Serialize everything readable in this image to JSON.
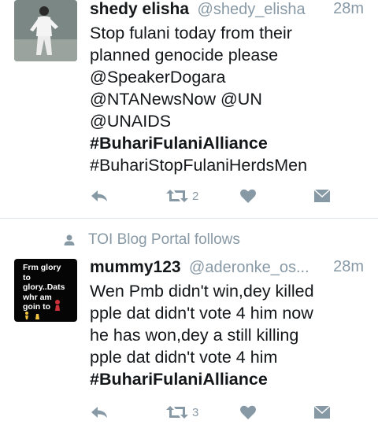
{
  "tweets": [
    {
      "name": "shedy elisha",
      "handle": "@shedy_elisha",
      "time": "28m",
      "lines": [
        "Stop fulani today from their",
        "planned genocide please",
        "@SpeakerDogara",
        "@NTANewsNow @UN",
        "@UNAIDS"
      ],
      "bold_line": "#BuhariFulaniAlliance",
      "tail_line": "#BuhariStopFulaniHerdsMen",
      "retweets": "2",
      "likes": ""
    },
    {
      "social_context": "TOI Blog Portal follows",
      "name": "mummy123",
      "handle": "@aderonke_os...",
      "time": "28m",
      "lines": [
        "Wen Pmb didn't win,dey killed",
        "pple dat didn't vote 4 him now",
        "he has won,dey a still killing",
        "pple dat didn't vote 4 him"
      ],
      "bold_line": "#BuhariFulaniAlliance",
      "avatar_text": [
        "Frm glory",
        "to",
        "glory..Dats",
        "whr am",
        "goin to"
      ],
      "retweets": "3",
      "likes": ""
    }
  ],
  "colors": {
    "text": "#14171a",
    "muted": "#8899a6",
    "divider": "#e1e8ed"
  },
  "icons": [
    "reply-icon",
    "retweet-icon",
    "heart-icon",
    "dm-icon",
    "person-icon"
  ]
}
